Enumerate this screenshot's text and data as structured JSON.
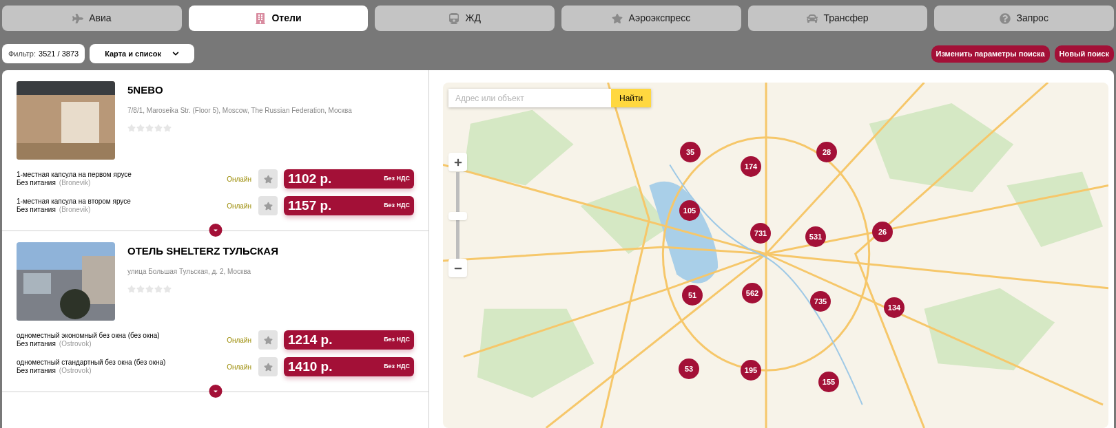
{
  "tabs": [
    {
      "label": "Авиа",
      "kind": "plane",
      "selected": false
    },
    {
      "label": "Отели",
      "kind": "hotel",
      "selected": true
    },
    {
      "label": "ЖД",
      "kind": "train",
      "selected": false
    },
    {
      "label": "Аэроэкспресс",
      "kind": "star",
      "selected": false
    },
    {
      "label": "Трансфер",
      "kind": "car",
      "selected": false
    },
    {
      "label": "Запрос",
      "kind": "question",
      "selected": false
    }
  ],
  "filter": {
    "label": "Фильтр:",
    "value": "3521 / 3873"
  },
  "view_select": {
    "value": "Карта и список"
  },
  "actions": [
    "Изменить параметры поиска",
    "Новый поиск"
  ],
  "hotels": [
    {
      "name": "5NEBO",
      "address": "7/8/1, Maroseika Str. (Floor 5), Moscow, The Russian Federation, Москва",
      "stars": 0,
      "kind": "interior",
      "rooms": [
        {
          "title": "1-местная капсула на первом ярусе",
          "meal": "Без питания",
          "provider": "(Bronevik)",
          "status": "Онлайн",
          "price": "1102 р.",
          "vat": "Без НДС"
        },
        {
          "title": "1-местная капсула на втором ярусе",
          "meal": "Без питания",
          "provider": "(Bronevik)",
          "status": "Онлайн",
          "price": "1157 р.",
          "vat": "Без НДС"
        }
      ]
    },
    {
      "name": "ОТЕЛЬ SHELTERZ ТУЛЬСКАЯ",
      "address": "улица Большая Тульская, д. 2, Москва",
      "stars": 0,
      "kind": "street",
      "rooms": [
        {
          "title": "одноместный экономный без окна (без окна)",
          "meal": "Без питания",
          "provider": "(Ostrovok)",
          "status": "Онлайн",
          "price": "1214 р.",
          "vat": "Без НДС"
        },
        {
          "title": "одноместный стандартный без окна (без окна)",
          "meal": "Без питания",
          "provider": "(Ostrovok)",
          "status": "Онлайн",
          "price": "1410 р.",
          "vat": "Без НДС"
        }
      ]
    }
  ],
  "map": {
    "zoom": {
      "level": 0.49
    },
    "search": {
      "placeholder": "Адрес или объект",
      "button": "Найти"
    },
    "clusters": [
      "35",
      "174",
      "28",
      "105",
      "731",
      "531",
      "26",
      "51",
      "562",
      "735",
      "134",
      "53",
      "195",
      "155"
    ]
  }
}
